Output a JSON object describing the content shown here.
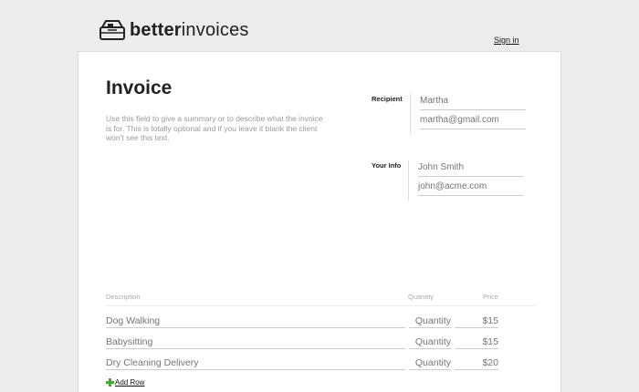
{
  "header": {
    "logo_bold": "better",
    "logo_light": "invoices",
    "sign_in_label": "Sign in"
  },
  "invoice": {
    "title": "Invoice",
    "summary_placeholder": "Use this field to give a summary or to describe what the invoice is for. This is totally optional and if you leave it blank the client won't see this text."
  },
  "recipient": {
    "label": "Recipient",
    "name_placeholder": "Martha",
    "email_placeholder": "martha@gmail.com"
  },
  "your_info": {
    "label": "Your Info",
    "name_placeholder": "John Smith",
    "email_placeholder": "john@acme.com"
  },
  "table": {
    "columns": [
      "Description",
      "Quantity",
      "Price"
    ],
    "rows": [
      {
        "description": "Dog Walking",
        "quantity": "Quantity",
        "price": "$15"
      },
      {
        "description": "Babysitting",
        "quantity": "Quantity",
        "price": "$15"
      },
      {
        "description": "Dry Cleaning Delivery",
        "quantity": "Quantity",
        "price": "$20"
      }
    ],
    "add_row_label": "Add Row"
  },
  "icons": {
    "logo": "invoice-stack-icon",
    "add": "plus-icon"
  },
  "colors": {
    "add_icon": "#49a83b",
    "page_background": "#ececec"
  }
}
